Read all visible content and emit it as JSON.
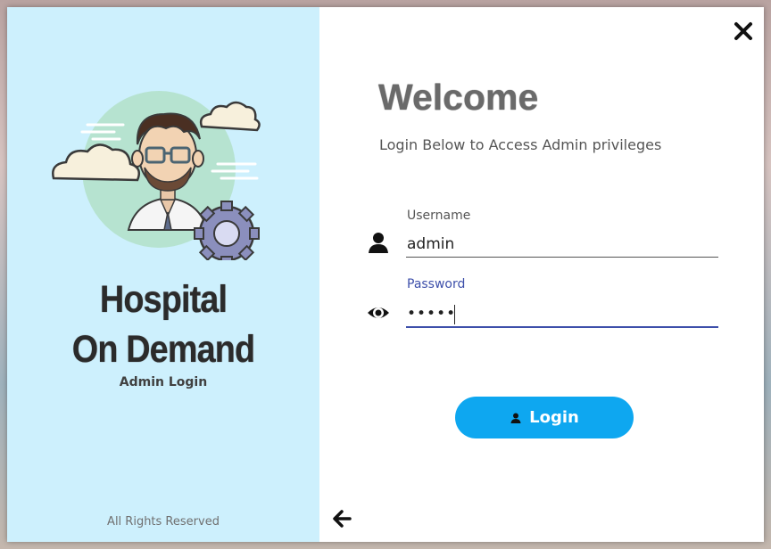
{
  "brand": {
    "title_line1": "Hospital",
    "title_line2": "On Demand",
    "subtitle": "Admin Login",
    "footer": "All Rights Reserved"
  },
  "header": {
    "welcome": "Welcome",
    "subtitle": "Login Below to Access Admin privileges"
  },
  "form": {
    "username_label": "Username",
    "username_value": "admin",
    "password_label": "Password",
    "password_value": "admin",
    "login_label": "Login"
  },
  "icons": {
    "close": "close-icon",
    "back": "arrow-left-icon",
    "username": "user-icon",
    "password": "eye-icon",
    "login": "user-icon"
  },
  "colors": {
    "left_panel": "#cdf0fd",
    "accent": "#0ea7f0",
    "focus": "#3d4faa"
  }
}
